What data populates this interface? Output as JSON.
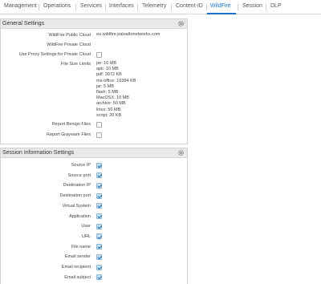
{
  "tabs": [
    {
      "label": "Management"
    },
    {
      "label": "Operations"
    },
    {
      "label": "Services"
    },
    {
      "label": "Interfaces"
    },
    {
      "label": "Telemetry"
    },
    {
      "label": "Content-ID"
    },
    {
      "label": "WildFire"
    },
    {
      "label": "Session"
    },
    {
      "label": "DLP"
    }
  ],
  "active_tab": "WildFire",
  "colors": {
    "accent": "#1a73c7",
    "header_bg": "#e9e9e9",
    "checkbox_checked": "#c7dff1"
  },
  "general": {
    "title": "General Settings",
    "public_cloud_label": "WildFire Public Cloud",
    "public_cloud_value": "eu.wildfire.paloaltonetworks.com",
    "private_cloud_label": "WildFire Private Cloud",
    "private_cloud_value": "",
    "proxy_label": "Use Proxy Settings for Private Cloud",
    "proxy_checked": false,
    "file_size_label": "File Size Limits",
    "file_sizes": [
      "pe: 16 MB",
      "apk: 10 MB",
      "pdf: 3072 KB",
      "ms-office: 16384 KB",
      "jar: 5 MB",
      "flash: 5 MB",
      "MacOSX: 10 MB",
      "archive: 50 MB",
      "linux: 50 MB",
      "script: 20 KB"
    ],
    "benign_label": "Report Benign Files",
    "benign_checked": false,
    "grayware_label": "Report Grayware Files",
    "grayware_checked": false
  },
  "session": {
    "title": "Session Information Settings",
    "items": [
      {
        "label": "Source IP",
        "checked": true
      },
      {
        "label": "Source port",
        "checked": true
      },
      {
        "label": "Destination IP",
        "checked": true
      },
      {
        "label": "Destination port",
        "checked": true
      },
      {
        "label": "Virtual System",
        "checked": true
      },
      {
        "label": "Application",
        "checked": true
      },
      {
        "label": "User",
        "checked": true
      },
      {
        "label": "URL",
        "checked": true
      },
      {
        "label": "File name",
        "checked": true
      },
      {
        "label": "Email sender",
        "checked": true
      },
      {
        "label": "Email recipient",
        "checked": true
      },
      {
        "label": "Email subject",
        "checked": true
      }
    ]
  }
}
